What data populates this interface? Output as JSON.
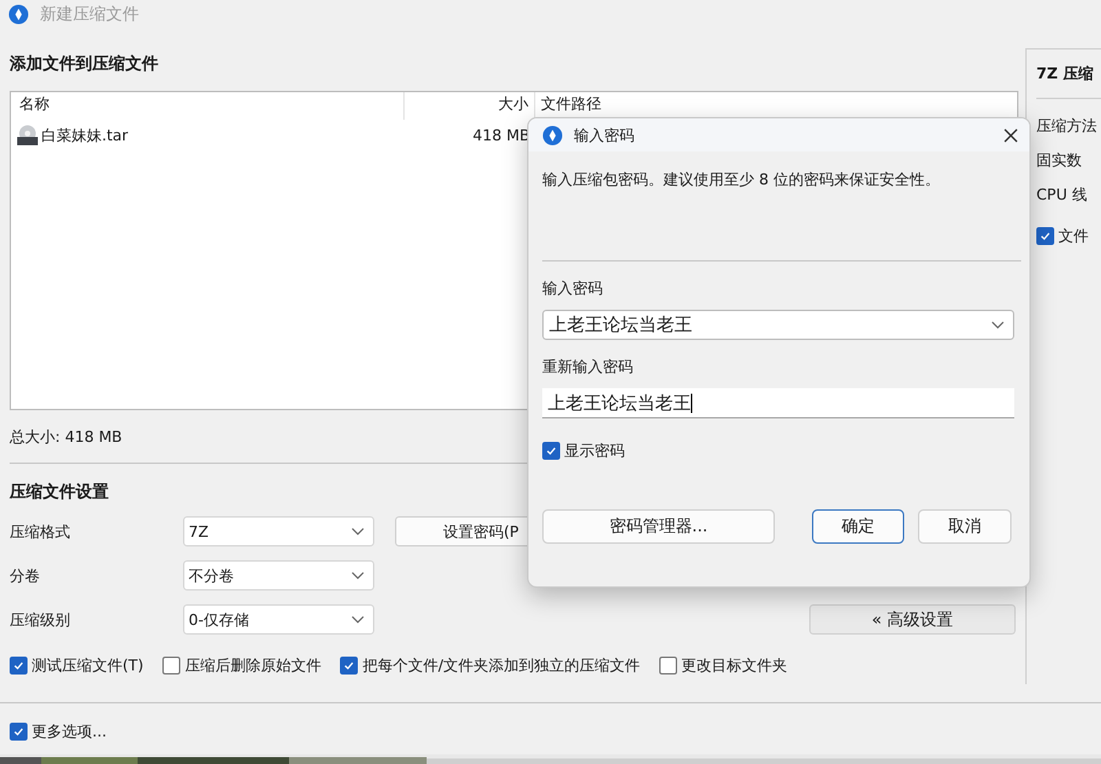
{
  "window": {
    "title": "新建压缩文件"
  },
  "files_section": {
    "heading": "添加文件到压缩文件",
    "columns": [
      "名称",
      "大小",
      "文件路径"
    ],
    "rows": [
      {
        "name": "白菜妹妹.tar",
        "size": "418 MB"
      }
    ],
    "total": "总大小: 418 MB"
  },
  "settings": {
    "heading": "压缩文件设置",
    "fields": [
      {
        "label": "压缩格式",
        "value": "7Z"
      },
      {
        "label": "分卷",
        "value": "不分卷"
      },
      {
        "label": "压缩级别",
        "value": "0-仅存储"
      }
    ],
    "password_button": "设置密码(P",
    "advanced_button": "« 高级设置",
    "options": [
      {
        "label": "测试压缩文件(T)",
        "checked": true
      },
      {
        "label": "压缩后删除原始文件",
        "checked": false
      },
      {
        "label": "把每个文件/文件夹添加到独立的压缩文件",
        "checked": true
      },
      {
        "label": "更改目标文件夹",
        "checked": false
      }
    ],
    "more_options": {
      "label": "更多选项...",
      "checked": true
    }
  },
  "right_panel": {
    "heading": "7Z 压缩",
    "rows": [
      "压缩方法",
      "固实数",
      "CPU 线"
    ],
    "option": {
      "label": "文件",
      "checked": true
    }
  },
  "dialog": {
    "title": "输入密码",
    "message": "输入压缩包密码。建议使用至少 8 位的密码来保证安全性。",
    "password_label": "输入密码",
    "password": "上老王论坛当老王",
    "confirm_label": "重新输入密码",
    "confirm": "上老王论坛当老王",
    "show_password": {
      "label": "显示密码",
      "checked": true
    },
    "buttons": [
      {
        "label": "密码管理器...",
        "kind": "manager"
      },
      {
        "label": "确定",
        "kind": "default"
      },
      {
        "label": "取消",
        "kind": "normal"
      }
    ]
  }
}
